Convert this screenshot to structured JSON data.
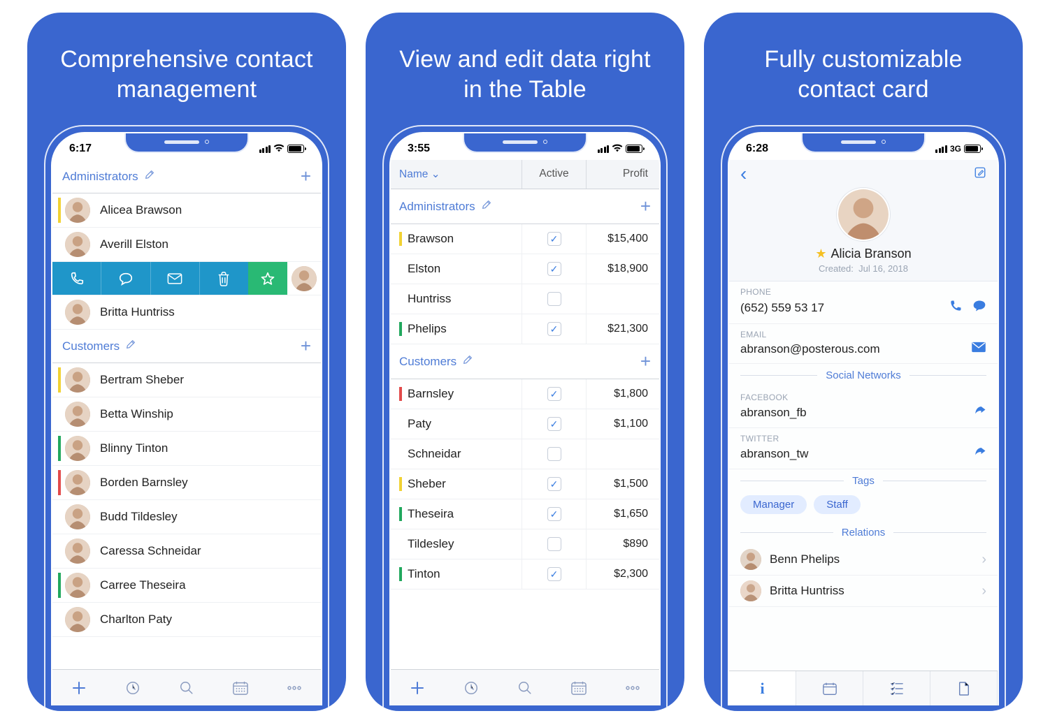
{
  "panels": [
    {
      "headline": "Comprehensive contact management",
      "time": "6:17",
      "network": "wifi"
    },
    {
      "headline": "View and edit data right in the Table",
      "time": "3:55",
      "network": "wifi"
    },
    {
      "headline": "Fully customizable contact card",
      "time": "6:28",
      "network": "3G"
    }
  ],
  "panel1": {
    "groups": [
      {
        "title": "Administrators",
        "rows": [
          {
            "name": "Alicea Brawson",
            "strip": "#f1d234"
          },
          {
            "name": "Averill Elston",
            "strip": "transparent"
          },
          {
            "swipe": true
          },
          {
            "name": "Britta Huntriss",
            "strip": "transparent"
          }
        ]
      },
      {
        "title": "Customers",
        "rows": [
          {
            "name": "Bertram Sheber",
            "strip": "#f1d234"
          },
          {
            "name": "Betta Winship",
            "strip": "transparent"
          },
          {
            "name": "Blinny Tinton",
            "strip": "#22a85e"
          },
          {
            "name": "Borden Barnsley",
            "strip": "#e24b4b"
          },
          {
            "name": "Budd Tildesley",
            "strip": "transparent"
          },
          {
            "name": "Caressa Schneidar",
            "strip": "transparent"
          },
          {
            "name": "Carree Theseira",
            "strip": "#22a85e"
          },
          {
            "name": "Charlton Paty",
            "strip": "transparent"
          }
        ]
      }
    ]
  },
  "panel2": {
    "columns": {
      "name": "Name",
      "active": "Active",
      "profit": "Profit"
    },
    "groups": [
      {
        "title": "Administrators",
        "rows": [
          {
            "name": "Brawson",
            "active": true,
            "profit": "$15,400",
            "strip": "#f1d234"
          },
          {
            "name": "Elston",
            "active": true,
            "profit": "$18,900",
            "strip": "transparent"
          },
          {
            "name": "Huntriss",
            "active": false,
            "profit": "",
            "strip": "transparent"
          },
          {
            "name": "Phelips",
            "active": true,
            "profit": "$21,300",
            "strip": "#22a85e"
          }
        ]
      },
      {
        "title": "Customers",
        "rows": [
          {
            "name": "Barnsley",
            "active": true,
            "profit": "$1,800",
            "strip": "#e24b4b"
          },
          {
            "name": "Paty",
            "active": true,
            "profit": "$1,100",
            "strip": "transparent"
          },
          {
            "name": "Schneidar",
            "active": false,
            "profit": "",
            "strip": "transparent"
          },
          {
            "name": "Sheber",
            "active": true,
            "profit": "$1,500",
            "strip": "#f1d234"
          },
          {
            "name": "Theseira",
            "active": true,
            "profit": "$1,650",
            "strip": "#22a85e"
          },
          {
            "name": "Tildesley",
            "active": false,
            "profit": "$890",
            "strip": "transparent"
          },
          {
            "name": "Tinton",
            "active": true,
            "profit": "$2,300",
            "strip": "#22a85e"
          }
        ]
      }
    ]
  },
  "panel3": {
    "name": "Alicia Branson",
    "created_label": "Created:",
    "created_date": "Jul 16, 2018",
    "phone_label": "PHONE",
    "phone": "(652) 559 53 17",
    "email_label": "EMAIL",
    "email": "abranson@posterous.com",
    "social_header": "Social Networks",
    "facebook_label": "FACEBOOK",
    "facebook": "abranson_fb",
    "twitter_label": "TWITTER",
    "twitter": "abranson_tw",
    "tags_header": "Tags",
    "tags": [
      "Manager",
      "Staff"
    ],
    "relations_header": "Relations",
    "relations": [
      "Benn Phelips",
      "Britta Huntriss"
    ]
  }
}
